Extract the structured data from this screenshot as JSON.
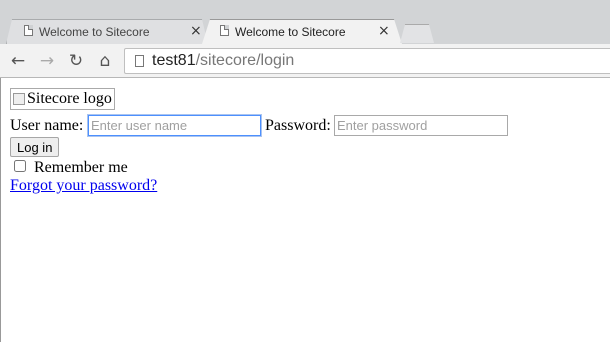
{
  "browser": {
    "tabs": [
      {
        "title": "Welcome to Sitecore",
        "active": false
      },
      {
        "title": "Welcome to Sitecore",
        "active": true
      }
    ],
    "close_glyph": "×",
    "nav": {
      "back": "←",
      "forward": "→",
      "reload": "↻",
      "home": "⌂"
    },
    "address": {
      "host": "test81",
      "path": "/sitecore/login"
    }
  },
  "page": {
    "logo_alt": "Sitecore logo",
    "username_label": "User name:",
    "username_placeholder": "Enter user name",
    "password_label": "Password:",
    "password_placeholder": "Enter password",
    "login_button": "Log in",
    "remember_label": "Remember me",
    "forgot_link": "Forgot your password?"
  },
  "colors": {
    "link": "#0000ee",
    "focus_border": "#4d90fe"
  }
}
